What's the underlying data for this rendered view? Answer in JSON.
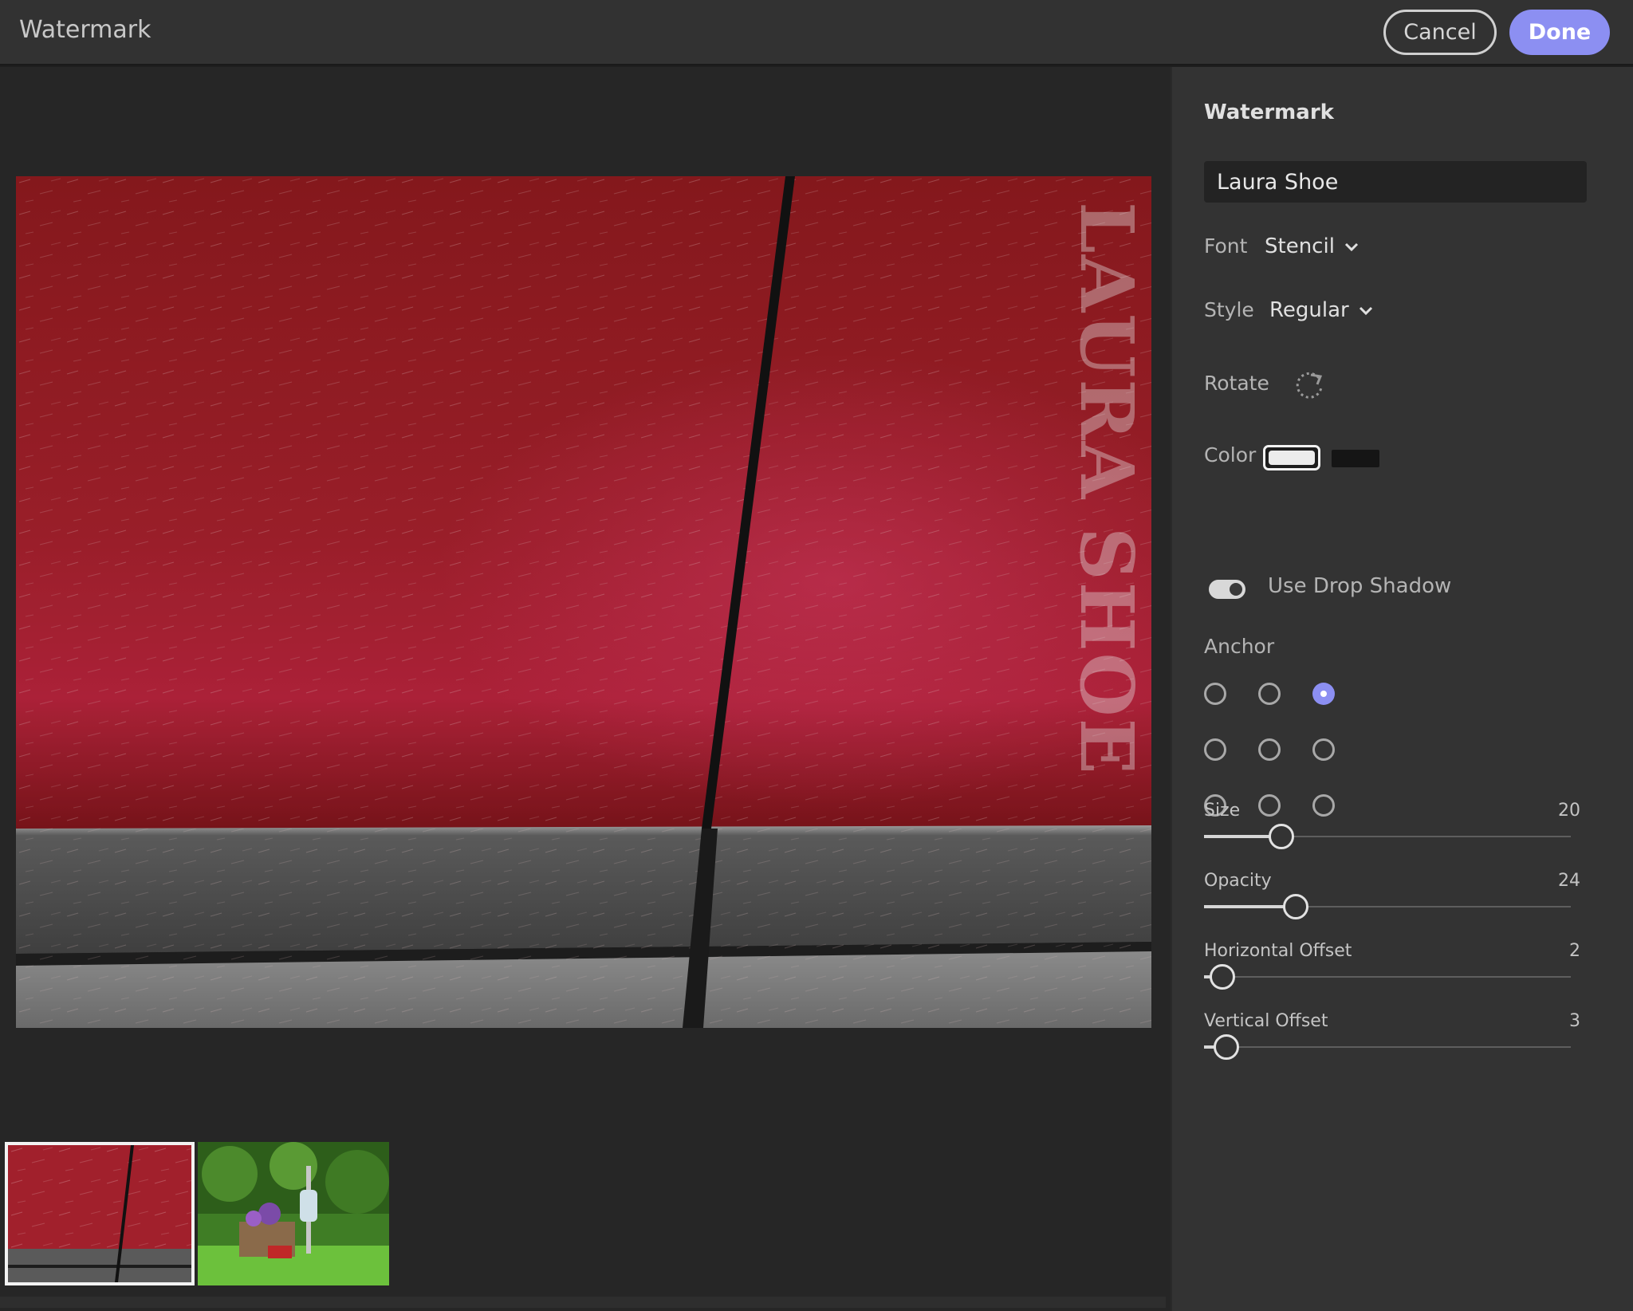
{
  "window": {
    "title": "Watermark"
  },
  "actions": {
    "cancel_label": "Cancel",
    "done_label": "Done"
  },
  "preview": {
    "watermark_text": "LAURA SHOE"
  },
  "filmstrip": {
    "selected_index": 0,
    "thumbnail_count": 2
  },
  "panel": {
    "title": "Watermark",
    "text_value": "Laura Shoe",
    "font": {
      "label": "Font",
      "value": "Stencil"
    },
    "style": {
      "label": "Style",
      "value": "Regular"
    },
    "rotate": {
      "label": "Rotate"
    },
    "color": {
      "label": "Color",
      "options": [
        "#ececec",
        "#151515"
      ],
      "selected": 0
    },
    "shadow": {
      "label": "Use Drop Shadow",
      "on": true
    },
    "anchor": {
      "label": "Anchor",
      "selected": 2
    },
    "sliders": [
      {
        "label": "Size",
        "value": "20",
        "fraction": 0.21
      },
      {
        "label": "Opacity",
        "value": "24",
        "fraction": 0.25
      },
      {
        "label": "Horizontal Offset",
        "value": "2",
        "fraction": 0.05
      },
      {
        "label": "Vertical Offset",
        "value": "3",
        "fraction": 0.06
      }
    ]
  }
}
